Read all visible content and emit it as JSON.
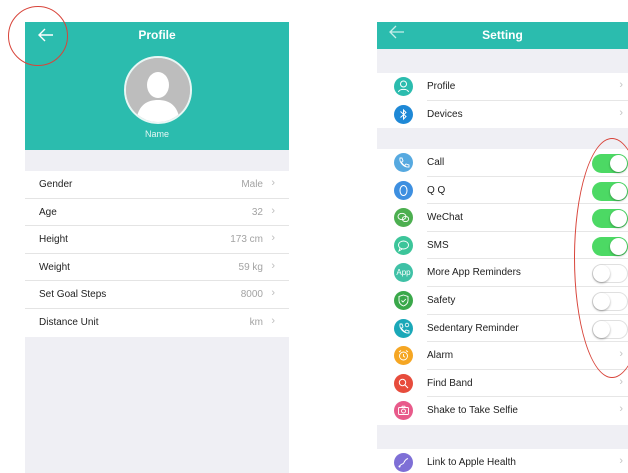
{
  "profile": {
    "title": "Profile",
    "back_icon": "arrow-left-icon",
    "avatar_icon": "default-avatar-icon",
    "name": "Name",
    "rows": [
      {
        "label": "Gender",
        "value": "Male"
      },
      {
        "label": "Age",
        "value": "32"
      },
      {
        "label": "Height",
        "value": "173 cm"
      },
      {
        "label": "Weight",
        "value": "59 kg"
      },
      {
        "label": "Set Goal Steps",
        "value": "8000"
      },
      {
        "label": "Distance Unit",
        "value": "km"
      }
    ]
  },
  "setting": {
    "title": "Setting",
    "back_icon": "arrow-left-icon",
    "group1": [
      {
        "label": "Profile",
        "icon": "person-icon",
        "color": "#2bbcae"
      },
      {
        "label": "Devices",
        "icon": "bluetooth-icon",
        "color": "#1e88d6"
      }
    ],
    "group2": [
      {
        "label": "Call",
        "icon": "phone-icon",
        "color": "#56a9e0",
        "toggle": true
      },
      {
        "label": "Q Q",
        "icon": "qq-icon",
        "color": "#3d8fe0",
        "toggle": true
      },
      {
        "label": "WeChat",
        "icon": "wechat-icon",
        "color": "#4caf50",
        "toggle": true
      },
      {
        "label": "SMS",
        "icon": "message-icon",
        "color": "#3cc59a",
        "toggle": true
      },
      {
        "label": "More App Reminders",
        "icon": "app-icon",
        "color": "#3fc1a6",
        "toggle": false
      },
      {
        "label": "Safety",
        "icon": "shield-icon",
        "color": "#3aa84a",
        "toggle": false
      },
      {
        "label": "Sedentary Reminder",
        "icon": "sedentary-icon",
        "color": "#1aa8b8",
        "toggle": false
      },
      {
        "label": "Alarm",
        "icon": "alarm-icon",
        "color": "#f5a623"
      },
      {
        "label": "Find Band",
        "icon": "search-icon",
        "color": "#e74c3c"
      },
      {
        "label": "Shake to Take Selfie",
        "icon": "camera-icon",
        "color": "#e85a8a"
      }
    ],
    "group3": [
      {
        "label": "Link to Apple Health",
        "icon": "health-icon",
        "color": "#7e6fd6"
      }
    ]
  }
}
